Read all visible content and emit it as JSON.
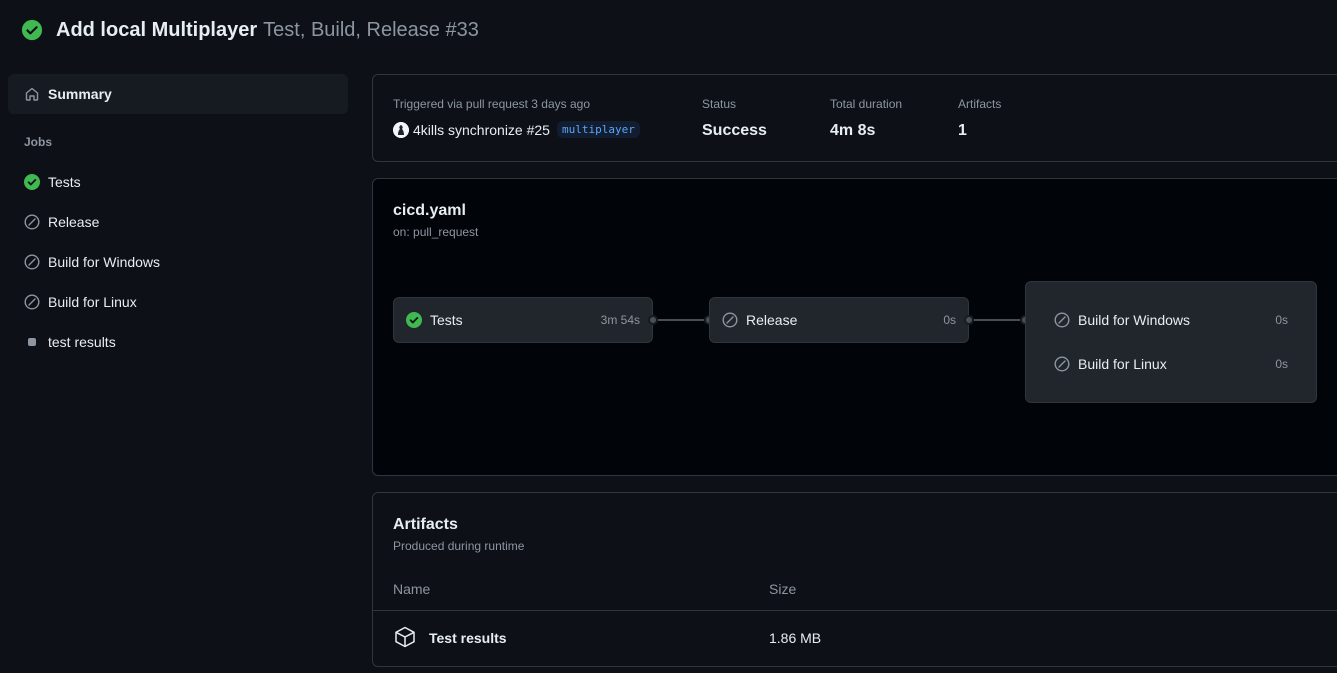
{
  "colors": {
    "success": "#3fb950",
    "skipped": "#8d96a0",
    "background": "#0d1117",
    "branch_text": "#58a6ff"
  },
  "header": {
    "status_icon": "check-circle-fill-icon",
    "title": "Add local Multiplayer",
    "subtitle": "Test, Build, Release #33"
  },
  "sidebar": {
    "summary_label": "Summary",
    "summary_icon": "home-icon",
    "jobs_heading": "Jobs",
    "jobs": [
      {
        "label": "Tests",
        "status": "success"
      },
      {
        "label": "Release",
        "status": "skipped"
      },
      {
        "label": "Build for Windows",
        "status": "skipped"
      },
      {
        "label": "Build for Linux",
        "status": "skipped"
      },
      {
        "label": "test results",
        "status": "dot"
      }
    ]
  },
  "summary": {
    "trigger_label": "Triggered via pull request 3 days ago",
    "trigger_text": "4kills synchronize #25",
    "branch": "multiplayer",
    "status_label": "Status",
    "status_value": "Success",
    "duration_label": "Total duration",
    "duration_value": "4m 8s",
    "artifacts_label": "Artifacts",
    "artifacts_value": "1"
  },
  "workflow": {
    "title": "cicd.yaml",
    "subtitle": "on: pull_request",
    "jobs": [
      {
        "name": "Tests",
        "duration": "3m 54s",
        "status": "success"
      },
      {
        "name": "Release",
        "duration": "0s",
        "status": "skipped"
      }
    ],
    "group": [
      {
        "name": "Build for Windows",
        "duration": "0s",
        "status": "skipped"
      },
      {
        "name": "Build for Linux",
        "duration": "0s",
        "status": "skipped"
      }
    ]
  },
  "artifacts": {
    "title": "Artifacts",
    "subtitle": "Produced during runtime",
    "col_name": "Name",
    "col_size": "Size",
    "items": [
      {
        "name": "Test results",
        "size": "1.86 MB",
        "icon": "package-icon"
      }
    ]
  }
}
